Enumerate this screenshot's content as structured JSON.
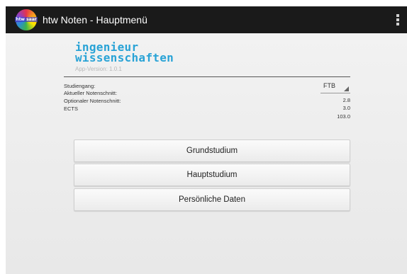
{
  "actionbar": {
    "app_icon_text": "htw saar",
    "title": "htw Noten - Hauptmenü"
  },
  "header": {
    "brand_line1": "ingenieur",
    "brand_line2": "wissenschaften",
    "version": "App-Version: 1.0.1"
  },
  "info": {
    "studiengang_label": "Studiengang:",
    "studiengang_value": "FTB",
    "aktueller_label": "Aktueller Notenschnitt:",
    "aktueller_value": "2.8",
    "optionaler_label": "Optionaler Notenschnitt:",
    "optionaler_value": "3.0",
    "ects_label": "ECTS",
    "ects_value": "103.0"
  },
  "buttons": {
    "grundstudium": "Grundstudium",
    "hauptstudium": "Hauptstudium",
    "persoenliche_daten": "Persönliche Daten"
  },
  "colors": {
    "actionbar": "#1a1a1a",
    "brand": "#29a3d6"
  }
}
